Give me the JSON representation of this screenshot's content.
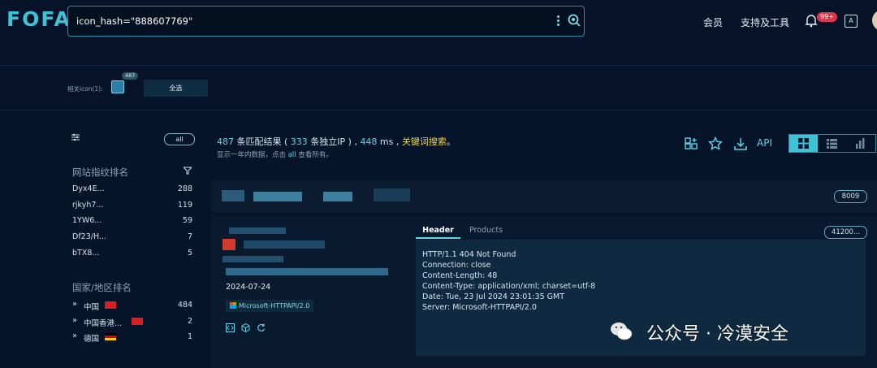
{
  "header": {
    "logo": "FOFA",
    "search_value": "icon_hash=\"888607769\"",
    "nav": [
      "会员",
      "支持及工具"
    ],
    "notification_badge": "99+"
  },
  "icon_bar": {
    "related_label": "相关icon(1):",
    "icon_count": "487",
    "select_all": "全选"
  },
  "sidebar": {
    "all_label": "all",
    "fingerprint_title": "网站指纹排名",
    "fingerprints": [
      {
        "name": "Dyx4E...",
        "count": "288"
      },
      {
        "name": "rjkyh7...",
        "count": "119"
      },
      {
        "name": "1YW6...",
        "count": "59"
      },
      {
        "name": "Df23/H...",
        "count": "7"
      },
      {
        "name": "bTX8...",
        "count": "5"
      }
    ],
    "country_title": "国家/地区排名",
    "countries": [
      {
        "name": "中国",
        "count": "484",
        "flag": "cn"
      },
      {
        "name": "中国香港...",
        "count": "2",
        "flag": "hk"
      },
      {
        "name": "德国",
        "count": "1",
        "flag": "de"
      }
    ]
  },
  "results": {
    "total": "487",
    "text1": " 条匹配结果 ( ",
    "unique_ip": "333",
    "text2": " 条独立IP ) , ",
    "time_ms": "448",
    "text3": " ms , ",
    "keyword_link": "关键词搜索",
    "text4": "。",
    "sub_text_pre": "显示一年内数据，点击 ",
    "sub_all": "all",
    "sub_text_post": " 查看所有。",
    "api_label": "API"
  },
  "card": {
    "port": "8009",
    "date": "2024-07-24",
    "server_tag": "Microsoft-HTTPAPI/2.0",
    "tabs": [
      "Header",
      "Products"
    ],
    "hash_pill": "41200...",
    "header_lines": [
      "HTTP/1.1 404 Not Found",
      "Connection: close",
      "Content-Length: 48",
      "Content-Type: application/xml; charset=utf-8",
      "Date: Tue, 23 Jul 2024 23:01:35 GMT",
      "Server: Microsoft-HTTPAPI/2.0"
    ]
  },
  "watermark": "公众号 · 冷漠安全",
  "colors": {
    "accent": "#3fc1d6",
    "keyword": "#f2d74a",
    "background": "#06142a"
  }
}
